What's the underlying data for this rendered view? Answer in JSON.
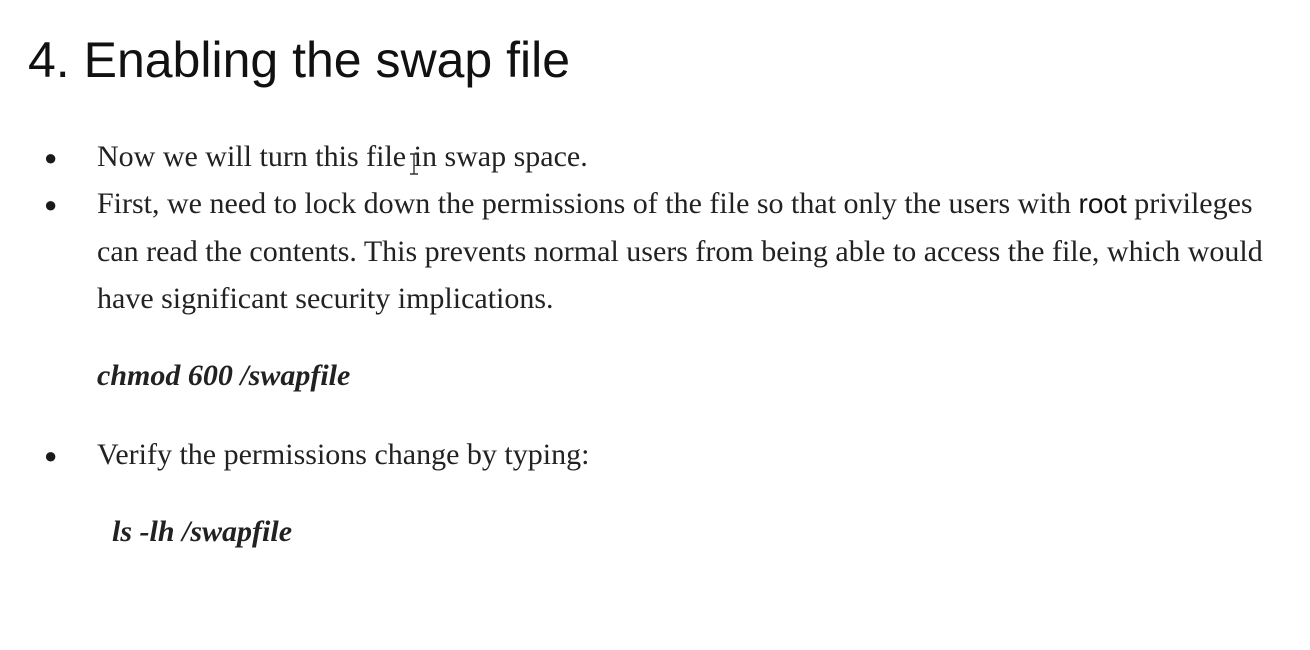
{
  "slide": {
    "title": "4. Enabling the swap file",
    "bullets": [
      {
        "marker": "●",
        "text": "Now we will turn this file in swap space."
      },
      {
        "marker": "●",
        "text_before": "First, we need to lock down the permissions of the file so that only the users with ",
        "highlight": "root",
        "text_after": " privileges can read the contents. This prevents normal users from being able to access the file, which would have significant security implications."
      },
      {
        "marker": "●",
        "text": "Verify the permissions change by typing:"
      }
    ],
    "commands": [
      "chmod 600 /swapfile",
      "ls -lh /swapfile"
    ]
  },
  "icons": {
    "cursor": "text-cursor-icon"
  }
}
